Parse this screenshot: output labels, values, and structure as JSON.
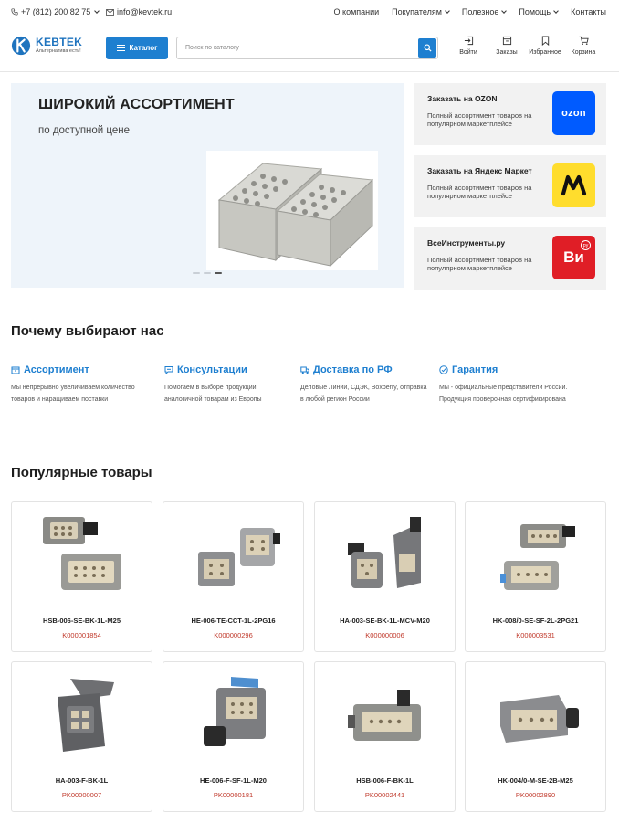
{
  "topbar": {
    "phone": "+7 (812) 200 82 75",
    "email": "info@kevtek.ru",
    "links": [
      {
        "label": "О компании",
        "dropdown": false
      },
      {
        "label": "Покупателям",
        "dropdown": true
      },
      {
        "label": "Полезное",
        "dropdown": true
      },
      {
        "label": "Помощь",
        "dropdown": true
      },
      {
        "label": "Контакты",
        "dropdown": false
      }
    ]
  },
  "header": {
    "logo_name": "KEBTEK",
    "logo_tagline": "Альтернатива есть!",
    "catalog_label": "Каталог",
    "search_placeholder": "Поиск по каталогу",
    "actions": [
      {
        "label": "Войти",
        "icon": "login-icon"
      },
      {
        "label": "Заказы",
        "icon": "orders-icon"
      },
      {
        "label": "Избранное",
        "icon": "bookmark-icon"
      },
      {
        "label": "Корзина",
        "icon": "cart-icon"
      }
    ]
  },
  "hero": {
    "title": "ШИРОКИЙ АССОРТИМЕНТ",
    "subtitle": "по доступной цене",
    "slides_total": 3,
    "active_slide": 3
  },
  "marketplaces": [
    {
      "title": "Заказать на OZON",
      "desc": "Полный ассортимент товаров на популярном маркетплейсе",
      "logo_text": "ozon",
      "color": "#005bff"
    },
    {
      "title": "Заказать на Яндекс Маркет",
      "desc": "Полный ассортимент товаров на популярном маркетплейсе",
      "logo_text": "",
      "color": "#ffdd2d"
    },
    {
      "title": "ВсеИнструменты.ру",
      "desc": "Полный ассортимент товаров на популярном маркетплейсе",
      "logo_text": "Ви",
      "logo_badge": "ру",
      "color": "#e01e26"
    }
  ],
  "why": {
    "heading": "Почему выбирают нас",
    "features": [
      {
        "title": "Ассортимент",
        "icon": "box-icon",
        "desc": "Мы непрерывно увеличиваем количество товаров и наращиваем поставки"
      },
      {
        "title": "Консультации",
        "icon": "chat-icon",
        "desc": "Помогаем в выборе продукции, аналогичной товарам из Европы"
      },
      {
        "title": "Доставка по РФ",
        "icon": "truck-icon",
        "desc": "Деловые Линии, СДЭК, Boxberry, отправка в любой регион России"
      },
      {
        "title": "Гарантия",
        "icon": "check-circle-icon",
        "desc": "Мы - официальные представители России. Продукция проверочная сертификирована"
      }
    ]
  },
  "popular": {
    "heading": "Популярные товары",
    "products": [
      {
        "name": "HSB-006-SE-BK-1L-M25",
        "sku": "K000001854"
      },
      {
        "name": "HE-006-TE-CCT-1L-2PG16",
        "sku": "K000000296"
      },
      {
        "name": "HA-003-SE-BK-1L-MCV-M20",
        "sku": "K000000006"
      },
      {
        "name": "HK-008/0-SE-SF-2L-2PG21",
        "sku": "K000003531"
      },
      {
        "name": "HA-003-F-BK-1L",
        "sku": "PK00000007"
      },
      {
        "name": "HE-006-F-SF-1L-M20",
        "sku": "PK00000181"
      },
      {
        "name": "HSB-006-F-BK-1L",
        "sku": "PK00002441"
      },
      {
        "name": "HK-004/0-M-SE-2B-M25",
        "sku": "PK00002890"
      }
    ]
  }
}
